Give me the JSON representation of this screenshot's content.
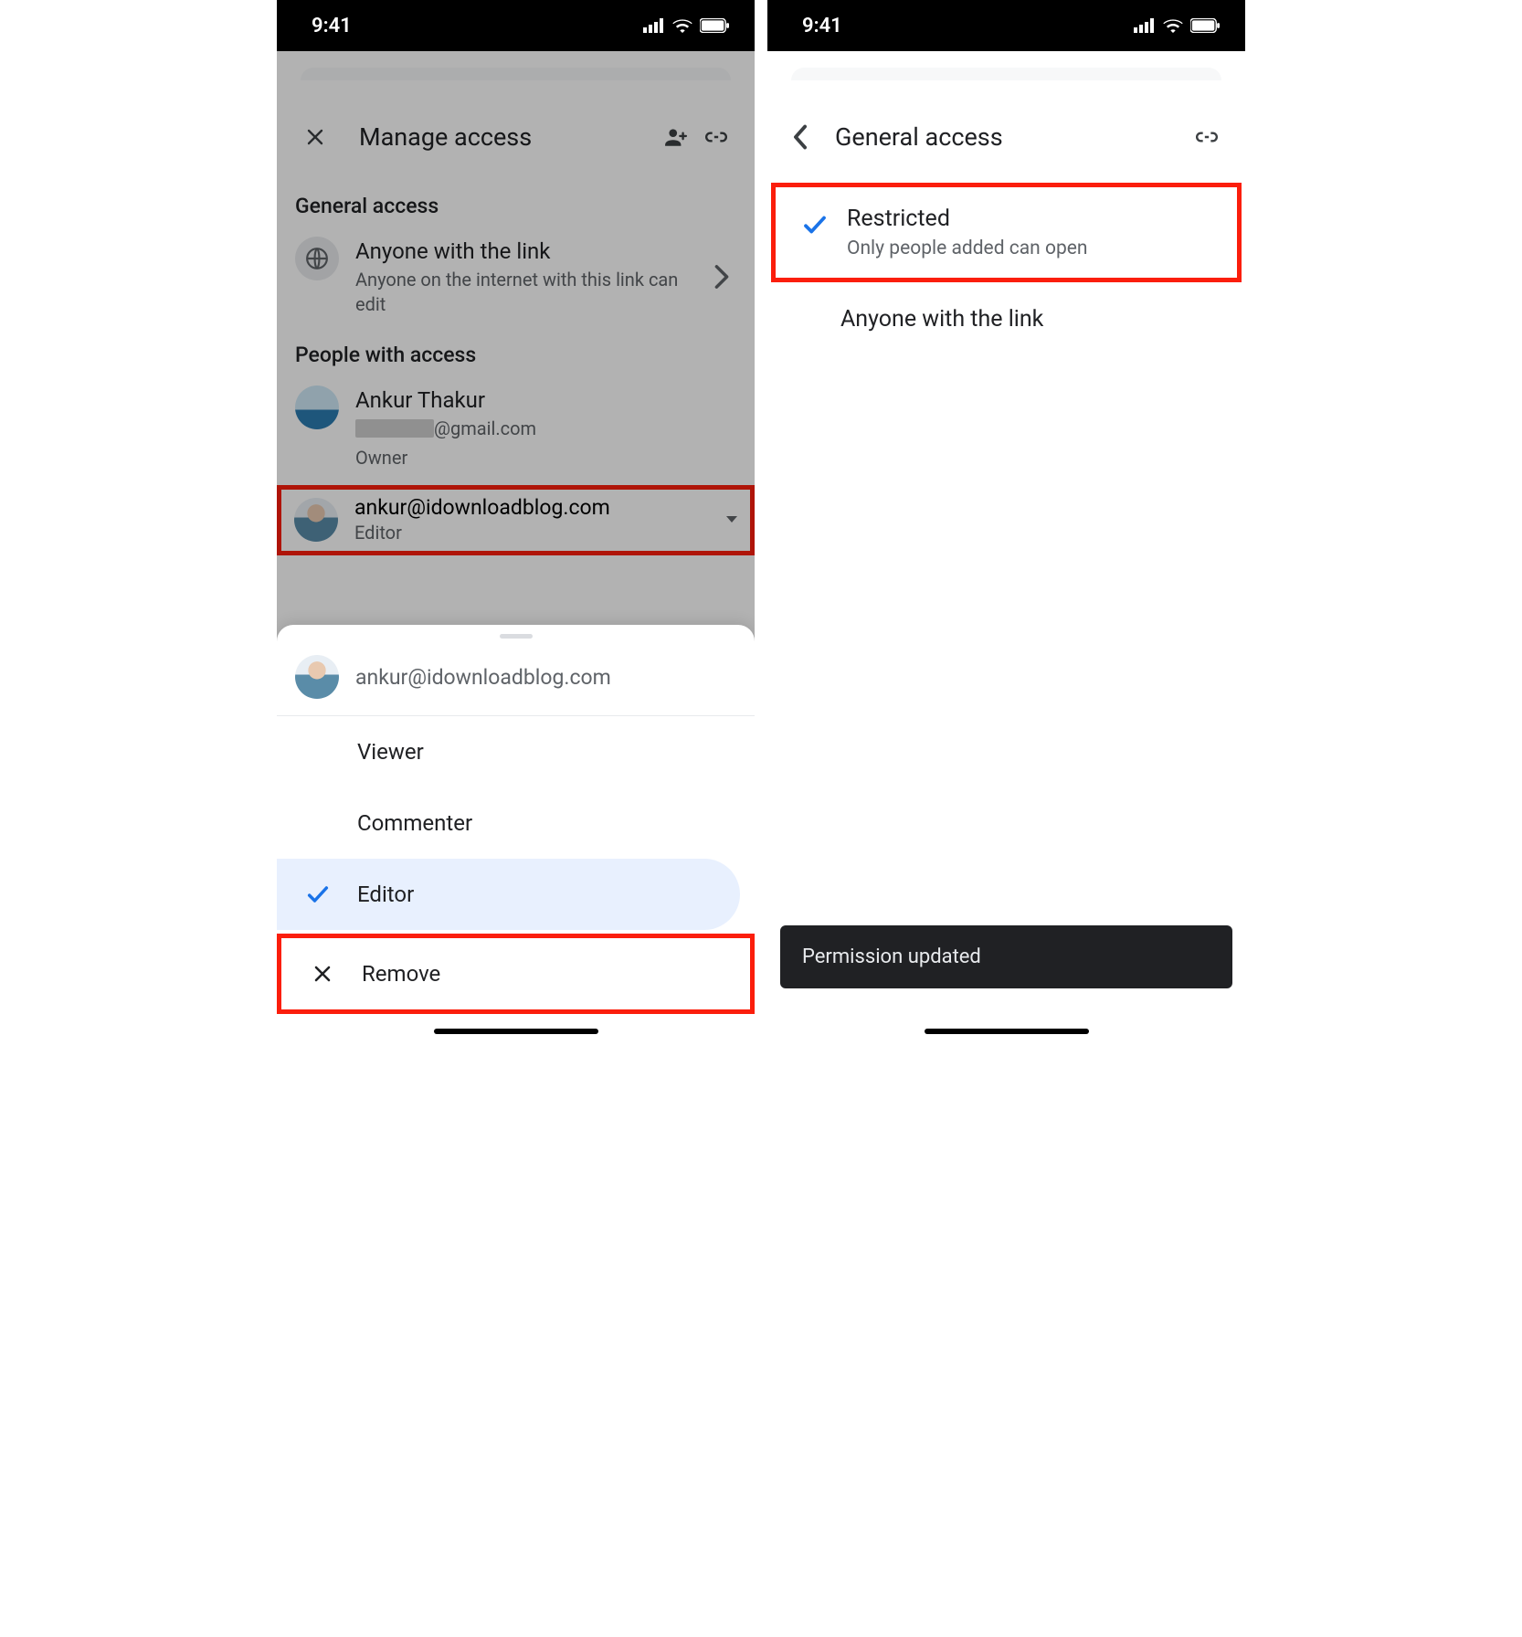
{
  "status": {
    "time": "9:41"
  },
  "left": {
    "header": {
      "title": "Manage access"
    },
    "general_access": {
      "section": "General access",
      "item_title": "Anyone with the link",
      "item_sub": "Anyone on the internet with this link can edit"
    },
    "people": {
      "section": "People with access",
      "owner": {
        "name": "Ankur Thakur",
        "email_suffix": "@gmail.com",
        "role": "Owner"
      },
      "editor": {
        "email": "ankur@idownloadblog.com",
        "role": "Editor"
      }
    },
    "sheet": {
      "email": "ankur@idownloadblog.com",
      "options": {
        "viewer": "Viewer",
        "commenter": "Commenter",
        "editor": "Editor",
        "remove": "Remove"
      }
    }
  },
  "right": {
    "header": {
      "title": "General access"
    },
    "restricted": {
      "title": "Restricted",
      "sub": "Only people added can open"
    },
    "anyone": "Anyone with the link",
    "toast": "Permission updated"
  }
}
